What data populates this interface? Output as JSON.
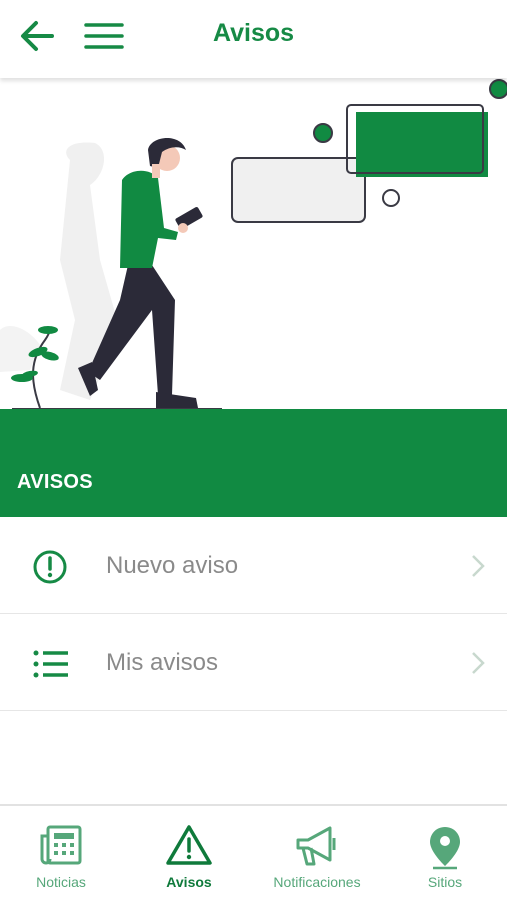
{
  "header": {
    "title": "Avisos",
    "back_icon": "arrow-left-icon",
    "menu_icon": "hamburger-menu-icon"
  },
  "hero": {
    "illustration": "person-walking-with-phone-illustration"
  },
  "banner": {
    "label": "AVISOS"
  },
  "list": [
    {
      "label": "Nuevo aviso",
      "icon": "exclamation-circle-icon"
    },
    {
      "label": "Mis avisos",
      "icon": "list-icon"
    }
  ],
  "tabbar": {
    "tabs": [
      {
        "label": "Noticias",
        "icon": "newspaper-icon",
        "active": false
      },
      {
        "label": "Avisos",
        "icon": "warning-triangle-icon",
        "active": true
      },
      {
        "label": "Notificaciones",
        "icon": "megaphone-icon",
        "active": false
      },
      {
        "label": "Sitios",
        "icon": "map-pin-icon",
        "active": false
      }
    ]
  },
  "colors": {
    "brand": "#118a42",
    "text_muted": "#8a8a8a",
    "tab_inactive": "#56a77a"
  }
}
